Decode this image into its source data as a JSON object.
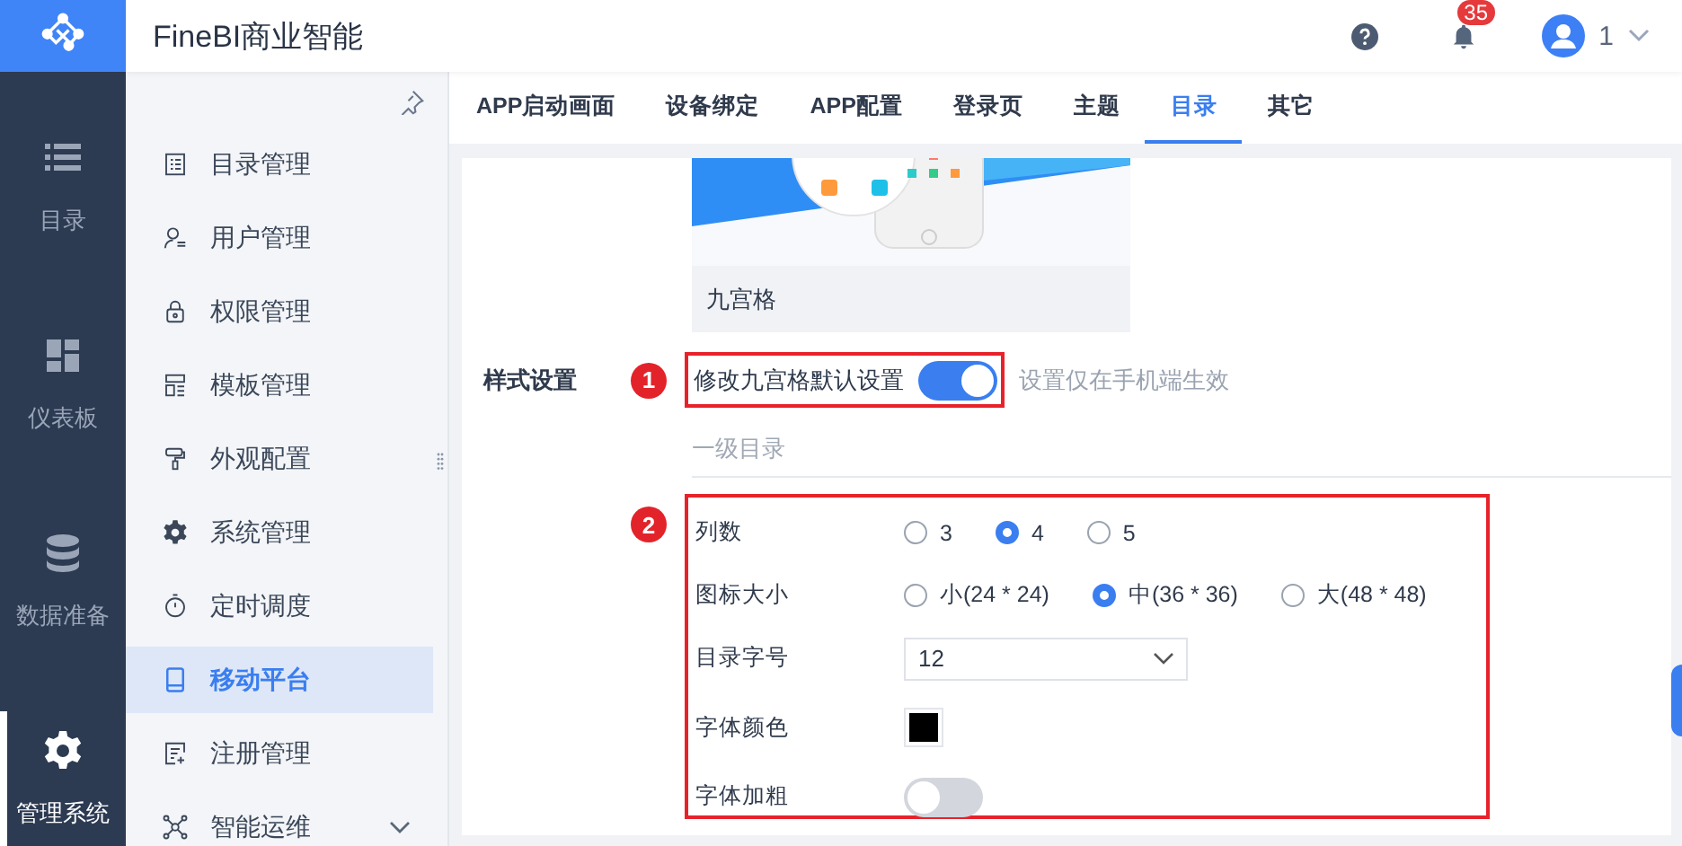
{
  "app": {
    "title": "FineBI商业智能"
  },
  "header": {
    "notification_count": "35",
    "user_name": "1"
  },
  "nav": [
    {
      "label": "目录",
      "selected": false
    },
    {
      "label": "仪表板",
      "selected": false
    },
    {
      "label": "数据准备",
      "selected": false
    },
    {
      "label": "管理系统",
      "selected": true
    }
  ],
  "menu": [
    {
      "label": "目录管理",
      "selected": false,
      "has_submenu": false
    },
    {
      "label": "用户管理",
      "selected": false,
      "has_submenu": false
    },
    {
      "label": "权限管理",
      "selected": false,
      "has_submenu": false
    },
    {
      "label": "模板管理",
      "selected": false,
      "has_submenu": false
    },
    {
      "label": "外观配置",
      "selected": false,
      "has_submenu": false
    },
    {
      "label": "系统管理",
      "selected": false,
      "has_submenu": false
    },
    {
      "label": "定时调度",
      "selected": false,
      "has_submenu": false
    },
    {
      "label": "移动平台",
      "selected": true,
      "has_submenu": false
    },
    {
      "label": "注册管理",
      "selected": false,
      "has_submenu": false
    },
    {
      "label": "智能运维",
      "selected": false,
      "has_submenu": true
    }
  ],
  "tabs": [
    {
      "label": "APP启动画面",
      "selected": false
    },
    {
      "label": "设备绑定",
      "selected": false
    },
    {
      "label": "APP配置",
      "selected": false
    },
    {
      "label": "登录页",
      "selected": false
    },
    {
      "label": "主题",
      "selected": false
    },
    {
      "label": "目录",
      "selected": true
    },
    {
      "label": "其它",
      "selected": false
    }
  ],
  "preview": {
    "caption": "九宫格"
  },
  "style_setting": {
    "label": "样式设置",
    "marker": "1",
    "toggle_label": "修改九宫格默认设置",
    "on": true,
    "hint": "设置仅在手机端生效"
  },
  "section_title": "一级目录",
  "group_marker": "2",
  "fields": [
    {
      "kind": "radio",
      "label": "列数",
      "options": [
        {
          "label": "3",
          "selected": false
        },
        {
          "label": "4",
          "selected": true
        },
        {
          "label": "5",
          "selected": false
        }
      ]
    },
    {
      "kind": "radio",
      "label": "图标大小",
      "options": [
        {
          "label": "小(24 * 24)",
          "selected": false
        },
        {
          "label": "中(36 * 36)",
          "selected": true
        },
        {
          "label": "大(48 * 48)",
          "selected": false
        }
      ]
    },
    {
      "kind": "select",
      "label": "目录字号",
      "value": "12"
    },
    {
      "kind": "color",
      "label": "字体颜色",
      "color": "#000000"
    },
    {
      "kind": "switch",
      "label": "字体加粗",
      "on": false
    }
  ]
}
